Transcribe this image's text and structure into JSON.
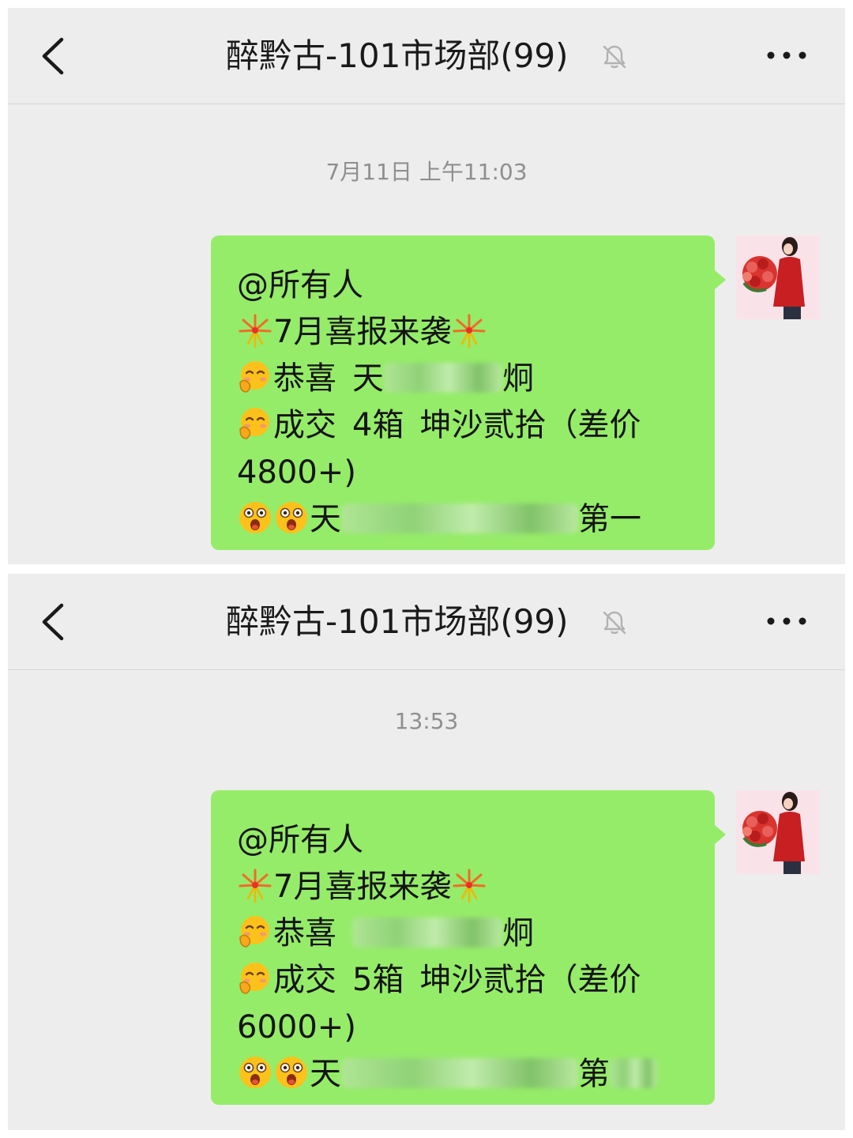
{
  "screens": [
    {
      "title": "醉黔古-101市场部(99)",
      "timestamp": "7月11日 上午11:03",
      "message": {
        "mention": "@所有人",
        "headline": "7月喜报来袭",
        "congrats_label": "恭喜",
        "congrats_visible_start": "天",
        "congrats_visible_end": "炯",
        "deal_prefix": "成交",
        "deal_count": "4箱",
        "deal_product": "坤沙贰拾（差价",
        "deal_amount": "4800+)",
        "rank_visible_start": "天",
        "rank_visible_end": "第一"
      }
    },
    {
      "title": "醉黔古-101市场部(99)",
      "timestamp": "13:53",
      "message": {
        "mention": "@所有人",
        "headline": "7月喜报来袭",
        "congrats_label": "恭喜",
        "congrats_visible_start": "",
        "congrats_visible_end": "炯",
        "deal_prefix": "成交",
        "deal_count": "5箱",
        "deal_product": "坤沙贰拾（差价",
        "deal_amount": "6000+)",
        "rank_visible_start": "天",
        "rank_visible_end": "第"
      }
    }
  ],
  "icons": {
    "back": "chevron-left-icon",
    "mute": "bell-slash-icon",
    "more": "ellipsis-icon",
    "fireworks": "fireworks-emoji",
    "shy": "shy-face-emoji",
    "surprised": "surprised-face-emoji"
  },
  "colors": {
    "background": "#ededed",
    "bubble": "#95ec69",
    "title_text": "#1a1a1a",
    "time_text": "#8f8f8f"
  }
}
